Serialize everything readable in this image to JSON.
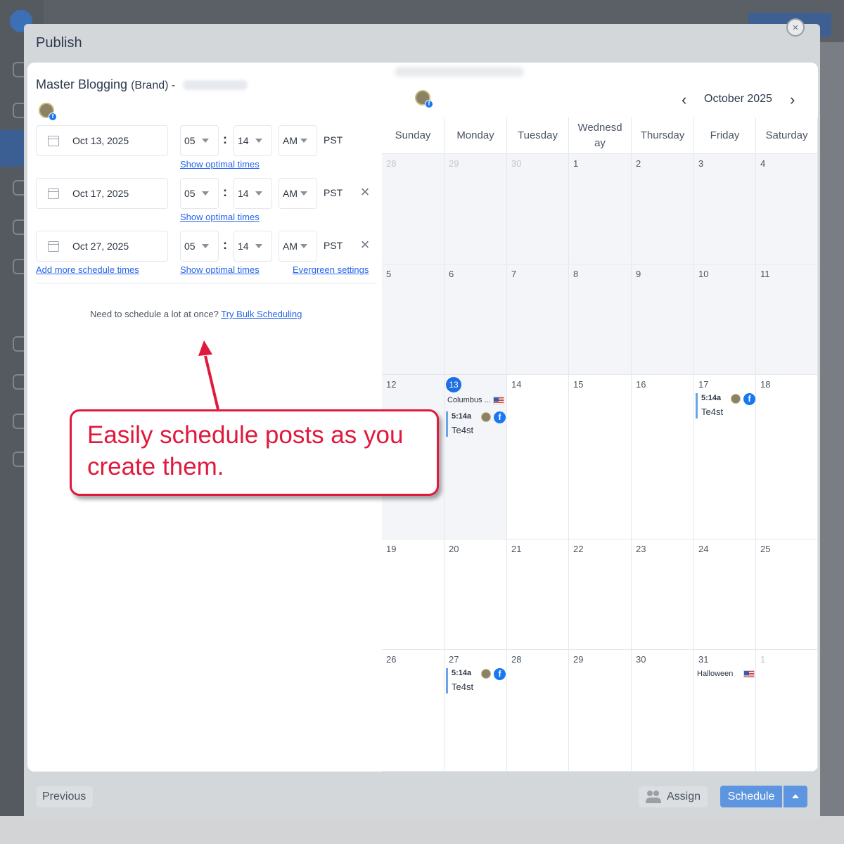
{
  "modal": {
    "title": "Publish",
    "close_icon": "×"
  },
  "composer": {
    "brand_name": "Master Blogging",
    "brand_suffix": "(Brand) -",
    "schedule_rows": [
      {
        "date": "Oct 13, 2025",
        "hour": "05",
        "minute": "14",
        "ampm": "AM",
        "timezone": "PST",
        "optimal_link": "Show optimal times"
      },
      {
        "date": "Oct 17, 2025",
        "hour": "05",
        "minute": "14",
        "ampm": "AM",
        "timezone": "PST",
        "optimal_link": "Show optimal times"
      },
      {
        "date": "Oct 27, 2025",
        "hour": "05",
        "minute": "14",
        "ampm": "AM",
        "timezone": "PST",
        "optimal_link": "Show optimal times"
      }
    ],
    "add_more_link": "Add more schedule times",
    "evergreen_link": "Evergreen settings",
    "bulk_text": "Need to schedule a lot at once?",
    "bulk_link": "Try Bulk Scheduling"
  },
  "calendar": {
    "month_label": "October 2025",
    "weekdays": [
      "Sunday",
      "Monday",
      "Tuesday",
      "Wednesd ay",
      "Thursday",
      "Friday",
      "Saturday"
    ],
    "weeks": [
      [
        "28",
        "29",
        "30",
        "1",
        "2",
        "3",
        "4"
      ],
      [
        "5",
        "6",
        "7",
        "8",
        "9",
        "10",
        "11"
      ],
      [
        "12",
        "13",
        "14",
        "15",
        "16",
        "17",
        "18"
      ],
      [
        "19",
        "20",
        "21",
        "22",
        "23",
        "24",
        "25"
      ],
      [
        "26",
        "27",
        "28",
        "29",
        "30",
        "31",
        "1"
      ]
    ],
    "holiday_columbus": "Columbus ...",
    "holiday_halloween": "Halloween",
    "events": [
      {
        "time": "5:14a",
        "title": "Te4st"
      },
      {
        "time": "5:14a",
        "title": "Te4st"
      },
      {
        "time": "5:14a",
        "title": "Te4st"
      }
    ],
    "facebook_glyph": "f",
    "accent_color": "#1d6fe3"
  },
  "callout": {
    "line1": "Easily schedule posts as you",
    "line2": "create them.",
    "color": "#e0193d"
  },
  "footer": {
    "previous_label": "Previous",
    "assign_label": "Assign",
    "schedule_label": "Schedule"
  }
}
